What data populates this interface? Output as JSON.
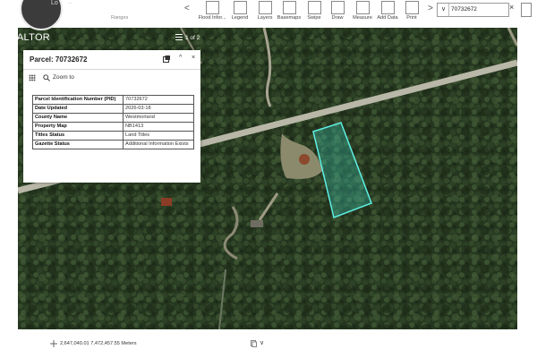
{
  "header": {
    "logo_text": "REALTOR",
    "logo_inner_text": "Lo",
    "muted_url": "...",
    "prev_tool_label": "Ranges"
  },
  "toolbar": {
    "tools": [
      {
        "id": "flood",
        "label": "Flood Infor...",
        "icon": "flood-icon"
      },
      {
        "id": "legend",
        "label": "Legend",
        "icon": "legend-icon"
      },
      {
        "id": "layers",
        "label": "Layers",
        "icon": "layers-icon"
      },
      {
        "id": "basemaps",
        "label": "Basemaps",
        "icon": "basemaps-icon"
      },
      {
        "id": "swipe",
        "label": "Swipe",
        "icon": "swipe-icon"
      },
      {
        "id": "draw",
        "label": "Draw",
        "icon": "draw-icon"
      },
      {
        "id": "measure",
        "label": "Measure",
        "icon": "measure-icon"
      },
      {
        "id": "adddata",
        "label": "Add Data",
        "icon": "add-data-icon"
      },
      {
        "id": "print",
        "label": "Print",
        "icon": "print-icon"
      }
    ],
    "prev_arrow": "<",
    "next_arrow": ">",
    "search": {
      "value": "70732672",
      "chevron": "∨",
      "close": "×"
    }
  },
  "paging": {
    "text": "1 of 2"
  },
  "popup": {
    "title": "Parcel: 70732672",
    "collapse": "^",
    "close": "×",
    "zoom_label": "Zoom to",
    "rows": [
      {
        "key": "Parcel Identification Number (PID)",
        "value": "70732672"
      },
      {
        "key": "Date Updated",
        "value": "2026-03-18"
      },
      {
        "key": "County Name",
        "value": "Westmorland"
      },
      {
        "key": "Property Map",
        "value": "NB1413"
      },
      {
        "key": "Titles Status",
        "value": "Land Titles"
      },
      {
        "key": "Gazette Status",
        "value": "Additional Information Exists"
      }
    ]
  },
  "footer": {
    "coordinates": "2,647,040.01 7,472,457.55 Meters",
    "chevron": "∨"
  },
  "colors": {
    "parcel_outline": "#5ff0e4",
    "parcel_fill": "#3fd9c8",
    "forest": "#24351f"
  }
}
